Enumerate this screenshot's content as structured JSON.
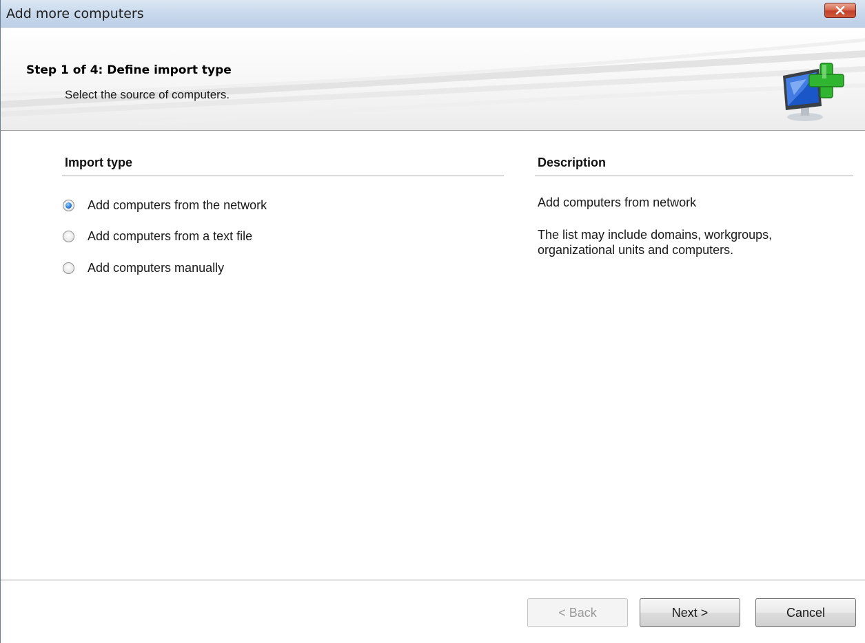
{
  "window": {
    "title": "Add more computers",
    "close_icon": "close-x-icon"
  },
  "header": {
    "step_title": "Step 1 of 4: Define import type",
    "subtitle": "Select the source of computers.",
    "icon": "monitor-add-icon"
  },
  "import_type": {
    "heading": "Import type",
    "options": [
      {
        "label": "Add computers from the network",
        "selected": true
      },
      {
        "label": "Add computers from a text file",
        "selected": false
      },
      {
        "label": "Add computers manually",
        "selected": false
      }
    ]
  },
  "description": {
    "heading": "Description",
    "title": "Add computers from network",
    "body": "The list may include domains, workgroups, organizational units and computers."
  },
  "buttons": {
    "back": "< Back",
    "next": "Next >",
    "cancel": "Cancel"
  },
  "colors": {
    "accent_blue": "#2b7cd3",
    "close_red": "#c2412a",
    "plus_green": "#2fb52f"
  }
}
